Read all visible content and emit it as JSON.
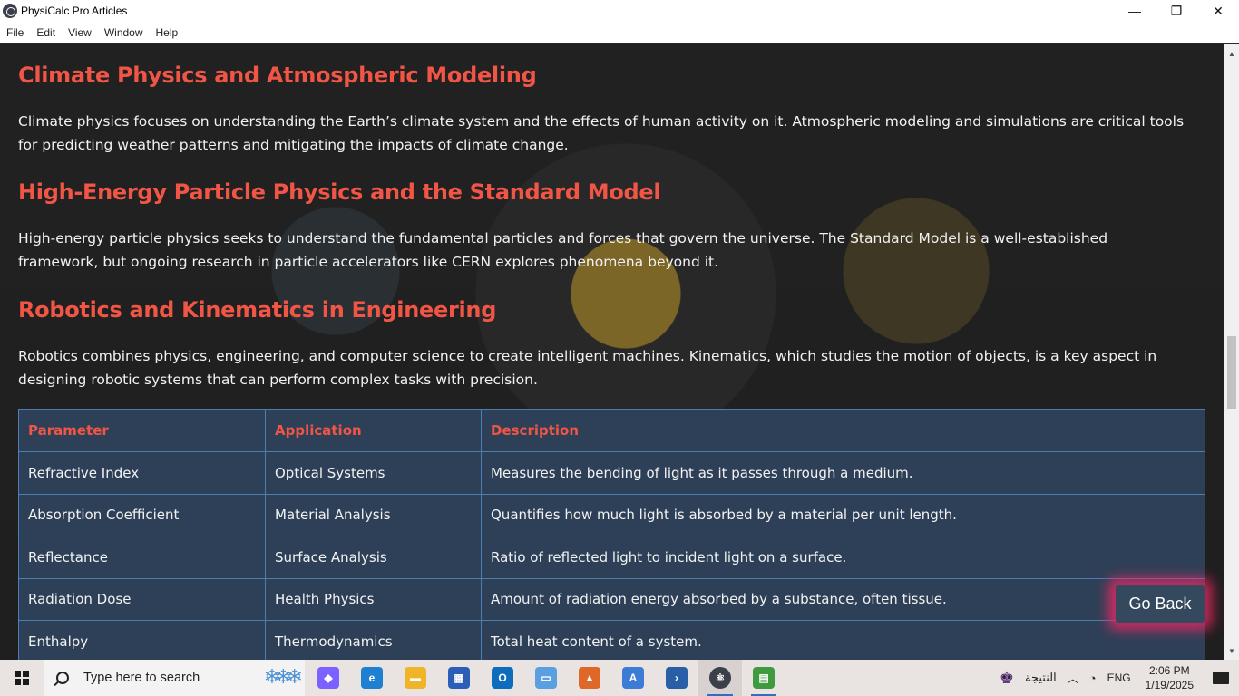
{
  "window": {
    "title": "PhysiCalc Pro Articles",
    "minimize_glyph": "—",
    "maximize_glyph": "❐",
    "close_glyph": "✕"
  },
  "menu": [
    "File",
    "Edit",
    "View",
    "Window",
    "Help"
  ],
  "article": {
    "sections": [
      {
        "title": "Climate Physics and Atmospheric Modeling",
        "text": "Climate physics focuses on understanding the Earth’s climate system and the effects of human activity on it. Atmospheric modeling and simulations are critical tools for predicting weather patterns and mitigating the impacts of climate change."
      },
      {
        "title": "High-Energy Particle Physics and the Standard Model",
        "text": "High-energy particle physics seeks to understand the fundamental particles and forces that govern the universe. The Standard Model is a well-established framework, but ongoing research in particle accelerators like CERN explores phenomena beyond it."
      },
      {
        "title": "Robotics and Kinematics in Engineering",
        "text": "Robotics combines physics, engineering, and computer science to create intelligent machines. Kinematics, which studies the motion of objects, is a key aspect in designing robotic systems that can perform complex tasks with precision."
      }
    ],
    "table": {
      "headers": [
        "Parameter",
        "Application",
        "Description"
      ],
      "rows": [
        [
          "Refractive Index",
          "Optical Systems",
          "Measures the bending of light as it passes through a medium."
        ],
        [
          "Absorption Coefficient",
          "Material Analysis",
          "Quantifies how much light is absorbed by a material per unit length."
        ],
        [
          "Reflectance",
          "Surface Analysis",
          "Ratio of reflected light to incident light on a surface."
        ],
        [
          "Radiation Dose",
          "Health Physics",
          "Amount of radiation energy absorbed by a substance, often tissue."
        ],
        [
          "Enthalpy",
          "Thermodynamics",
          "Total heat content of a system."
        ]
      ]
    },
    "go_back_label": "Go Back"
  },
  "colors": {
    "heading": "#f05545",
    "table_bg": "#2e4057",
    "table_border": "#4a7fb3",
    "go_back_glow": "#eb2864"
  },
  "taskbar": {
    "search_placeholder": "Type here to search",
    "apps": [
      {
        "icon": "copilot-icon",
        "color": "#7b61ff",
        "glyph": "◆"
      },
      {
        "icon": "edge-icon",
        "color": "#1f7fd1",
        "glyph": "e"
      },
      {
        "icon": "file-explorer-icon",
        "color": "#f0b429",
        "glyph": "▬"
      },
      {
        "icon": "store-icon",
        "color": "#2b5fb7",
        "glyph": "▦"
      },
      {
        "icon": "outlook-icon",
        "color": "#0f6cbd",
        "glyph": "O"
      },
      {
        "icon": "remote-desktop-icon",
        "color": "#5aa0e0",
        "glyph": "▭"
      },
      {
        "icon": "matlab-icon",
        "color": "#e0672a",
        "glyph": "▲"
      },
      {
        "icon": "app-a-icon",
        "color": "#3c7bd6",
        "glyph": "A"
      },
      {
        "icon": "powershell-icon",
        "color": "#2a5fa8",
        "glyph": "›"
      },
      {
        "icon": "physicalc-icon",
        "color": "#3a3f4a",
        "glyph": "⚛"
      },
      {
        "icon": "chart-app-icon",
        "color": "#3f9b3f",
        "glyph": "▤"
      }
    ],
    "tray_language_label": "النتيجة",
    "tray_lang": "ENG",
    "time": "2:06 PM",
    "date": "1/19/2025"
  }
}
